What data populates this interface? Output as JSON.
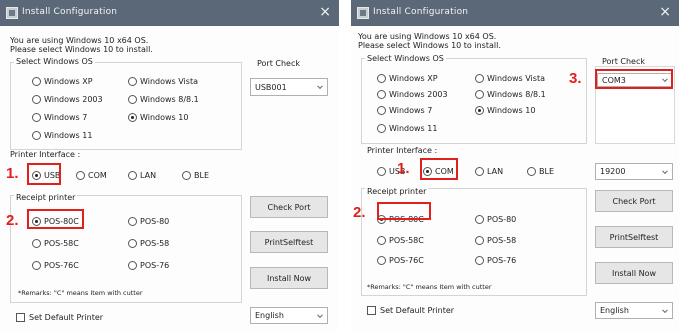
{
  "left": {
    "title": "Install Configuration",
    "close": "×",
    "info_line1": "You are using Windows 10 x64 OS.",
    "info_line2": "Please select Windows 10 to install.",
    "windows_os_label": "Select Windows OS",
    "os_options": [
      {
        "label": "Windows XP",
        "selected": false
      },
      {
        "label": "Windows Vista",
        "selected": false
      },
      {
        "label": "Windows 2003",
        "selected": false
      },
      {
        "label": "Windows 8/8.1",
        "selected": false
      },
      {
        "label": "Windows 7",
        "selected": false
      },
      {
        "label": "Windows 10",
        "selected": true
      },
      {
        "label": "Windows 11",
        "selected": false
      }
    ],
    "port_check_label": "Port Check",
    "port_value": "USB001",
    "printer_interface_label": "Printer Interface :",
    "interfaces": [
      {
        "label": "USB",
        "selected": true
      },
      {
        "label": "COM",
        "selected": false
      },
      {
        "label": "LAN",
        "selected": false
      },
      {
        "label": "BLE",
        "selected": false
      }
    ],
    "receipt_printer_label": "Receipt printer",
    "printers": [
      {
        "label": "POS-80C",
        "selected": true
      },
      {
        "label": "POS-80",
        "selected": false
      },
      {
        "label": "POS-58C",
        "selected": false
      },
      {
        "label": "POS-58",
        "selected": false
      },
      {
        "label": "POS-76C",
        "selected": false
      },
      {
        "label": "POS-76",
        "selected": false
      }
    ],
    "remarks": "*Remarks: \"C\" means Item with cutter",
    "check_port_btn": "Check Port",
    "print_selftest_btn": "PrintSelftest",
    "install_now_btn": "Install Now",
    "language": "English",
    "default_printer_label": "Set Default Printer",
    "annotations": [
      "1.",
      "2."
    ]
  },
  "right": {
    "title": "Install Configuration",
    "close": "×",
    "info_line1": "You are using Windows 10 x64 OS.",
    "info_line2": "Please select Windows 10 to install.",
    "windows_os_label": "Select Windows OS",
    "os_options": [
      {
        "label": "Windows XP",
        "selected": false
      },
      {
        "label": "Windows Vista",
        "selected": false
      },
      {
        "label": "Windows 2003",
        "selected": false
      },
      {
        "label": "Windows 8/8.1",
        "selected": false
      },
      {
        "label": "Windows 7",
        "selected": false
      },
      {
        "label": "Windows 10",
        "selected": true
      },
      {
        "label": "Windows 11",
        "selected": false
      }
    ],
    "port_check_label": "Port Check",
    "port_value": "COM3",
    "printer_interface_label": "Printer Interface :",
    "interfaces": [
      {
        "label": "USB",
        "selected": false
      },
      {
        "label": "COM",
        "selected": true
      },
      {
        "label": "LAN",
        "selected": false
      },
      {
        "label": "BLE",
        "selected": false
      }
    ],
    "baud_rate": "19200",
    "receipt_printer_label": "Receipt printer",
    "printers": [
      {
        "label": "POS-80C",
        "selected": true
      },
      {
        "label": "POS-80",
        "selected": false
      },
      {
        "label": "POS-58C",
        "selected": false
      },
      {
        "label": "POS-58",
        "selected": false
      },
      {
        "label": "POS-76C",
        "selected": false
      },
      {
        "label": "POS-76",
        "selected": false
      }
    ],
    "remarks": "*Remarks: \"C\" means Item with cutter",
    "check_port_btn": "Check Port",
    "print_selftest_btn": "PrintSelftest",
    "install_now_btn": "Install Now",
    "language": "English",
    "default_printer_label": "Set Default Printer",
    "annotations": [
      "1.",
      "2.",
      "3."
    ]
  },
  "colors": {
    "titlebar": "#5a6878",
    "annotation": "#e0201e"
  }
}
